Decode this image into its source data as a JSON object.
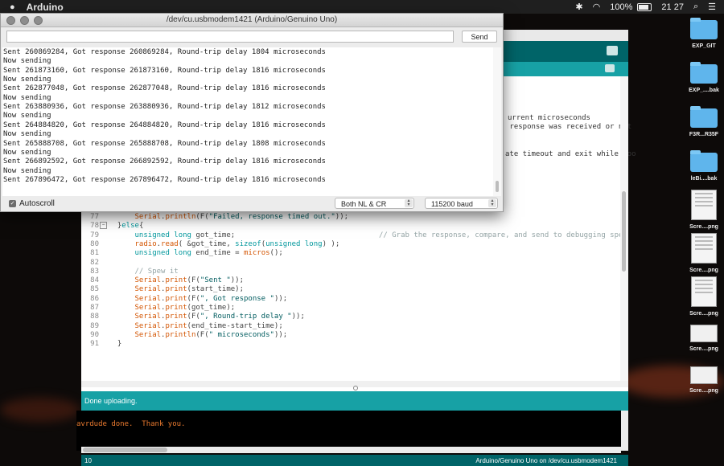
{
  "menubar": {
    "app_name": "Arduino",
    "battery": "100%",
    "clock": "21 27"
  },
  "desktop_icons": [
    {
      "label": "EXP_GIT",
      "kind": "folder"
    },
    {
      "label": "EXP_....bak",
      "kind": "folder"
    },
    {
      "label": "F3R...R35F",
      "kind": "folder"
    },
    {
      "label": "leBi....bak",
      "kind": "folder"
    },
    {
      "label": "Scre....png",
      "kind": "thumb"
    },
    {
      "label": "Scre....png",
      "kind": "thumb"
    },
    {
      "label": "Scre....png",
      "kind": "thumb"
    },
    {
      "label": "Scre....png",
      "kind": "thumb-wide"
    },
    {
      "label": "Scre....png",
      "kind": "thumb-wide"
    }
  ],
  "serial_monitor": {
    "title": "/dev/cu.usbmodem1421 (Arduino/Genuino Uno)",
    "send_input_value": "",
    "send_label": "Send",
    "output_lines": [
      "Sent 260869284, Got response 260869284, Round-trip delay 1804 microseconds",
      "Now sending",
      "Sent 261873160, Got response 261873160, Round-trip delay 1816 microseconds",
      "Now sending",
      "Sent 262877048, Got response 262877048, Round-trip delay 1816 microseconds",
      "Now sending",
      "Sent 263880936, Got response 263880936, Round-trip delay 1812 microseconds",
      "Now sending",
      "Sent 264884820, Got response 264884820, Round-trip delay 1816 microseconds",
      "Now sending",
      "Sent 265888708, Got response 265888708, Round-trip delay 1808 microseconds",
      "Now sending",
      "Sent 266892592, Got response 266892592, Round-trip delay 1816 microseconds",
      "Now sending",
      "Sent 267896472, Got response 267896472, Round-trip delay 1816 microseconds"
    ],
    "autoscroll_label": "Autoscroll",
    "autoscroll_checked": true,
    "line_ending": "Both NL & CR",
    "baud_rate": "115200 baud"
  },
  "ide": {
    "behind_text": [
      "urrent microseconds",
      " response was received or not",
      "ate timeout and exit while loo"
    ],
    "code_lines": [
      {
        "num": "77",
        "fold": "",
        "text": "      Serial.println(F(\"Failed, response timed out.\"));"
      },
      {
        "num": "78",
        "fold": "⊟",
        "text": "  }else{"
      },
      {
        "num": "79",
        "fold": "",
        "text": "      unsigned long got_time;                                 // Grab the response, compare, and send to debugging spew"
      },
      {
        "num": "80",
        "fold": "",
        "text": "      radio.read( &got_time, sizeof(unsigned long) );"
      },
      {
        "num": "81",
        "fold": "",
        "text": "      unsigned long end_time = micros();"
      },
      {
        "num": "82",
        "fold": "",
        "text": ""
      },
      {
        "num": "83",
        "fold": "",
        "text": "      // Spew it"
      },
      {
        "num": "84",
        "fold": "",
        "text": "      Serial.print(F(\"Sent \"));"
      },
      {
        "num": "85",
        "fold": "",
        "text": "      Serial.print(start_time);"
      },
      {
        "num": "86",
        "fold": "",
        "text": "      Serial.print(F(\", Got response \"));"
      },
      {
        "num": "87",
        "fold": "",
        "text": "      Serial.print(got_time);"
      },
      {
        "num": "88",
        "fold": "",
        "text": "      Serial.print(F(\", Round-trip delay \"));"
      },
      {
        "num": "89",
        "fold": "",
        "text": "      Serial.print(end_time-start_time);"
      },
      {
        "num": "90",
        "fold": "",
        "text": "      Serial.println(F(\" microseconds\"));"
      },
      {
        "num": "91",
        "fold": "",
        "text": "  }"
      }
    ],
    "status_message": "Done uploading.",
    "console_message": "avrdude done.  Thank you.",
    "footer_line": "10",
    "footer_board": "Arduino/Genuino Uno on /dev/cu.usbmodem1421"
  },
  "colors": {
    "ide_dark_teal": "#006468",
    "ide_teal": "#17a1a5",
    "console_orange": "#ea7a2f"
  }
}
